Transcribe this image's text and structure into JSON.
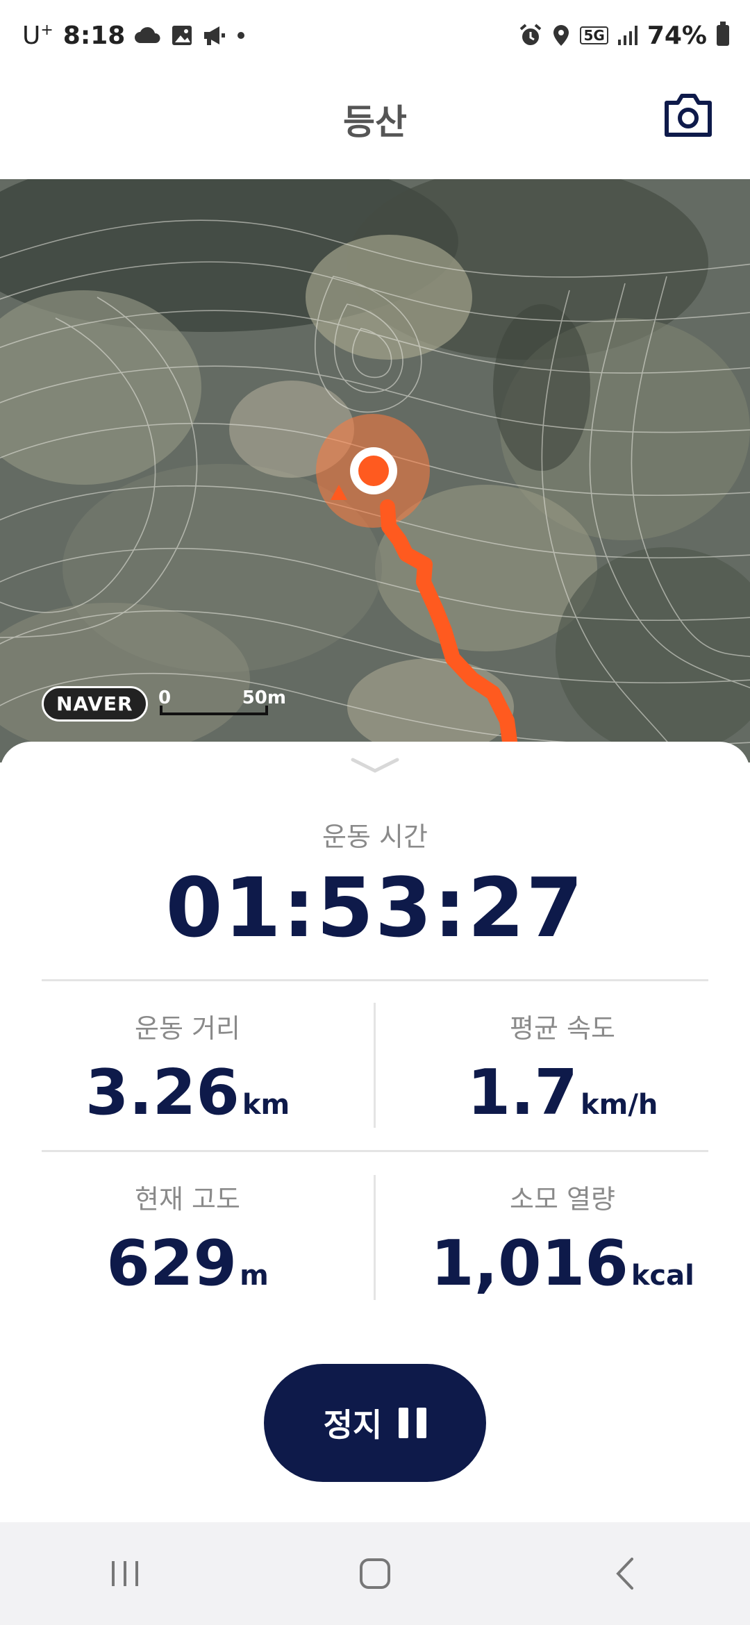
{
  "status_bar": {
    "carrier": "U",
    "carrier_sup": "+",
    "time": "8:18",
    "network": "5G",
    "battery": "74%",
    "icons_left": [
      "cloud-icon",
      "image-icon",
      "megaphone-icon",
      "dot-icon"
    ],
    "icons_right": [
      "alarm-icon",
      "location-icon",
      "5g-icon",
      "signal-icon",
      "battery-icon"
    ]
  },
  "header": {
    "title": "등산",
    "camera_icon": "camera-icon"
  },
  "map": {
    "provider": "NAVER",
    "scale_start": "0",
    "scale_end": "50m",
    "route_color": "#ff5a1f",
    "marker_color": "#ff5a1f"
  },
  "workout": {
    "time_label": "운동 시간",
    "time_value": "01:53:27",
    "distance_label": "운동 거리",
    "distance_value": "3.26",
    "distance_unit": "km",
    "speed_label": "평균 속도",
    "speed_value": "1.7",
    "speed_unit": "km/h",
    "altitude_label": "현재 고도",
    "altitude_value": "629",
    "altitude_unit": "m",
    "calories_label": "소모 열량",
    "calories_value": "1,016",
    "calories_unit": "kcal"
  },
  "stop_button": {
    "label": "정지",
    "icon": "pause-icon",
    "color": "#0e1a4a"
  },
  "nav_bar": {
    "recent": "recent-apps-icon",
    "home": "home-icon",
    "back": "back-icon"
  }
}
